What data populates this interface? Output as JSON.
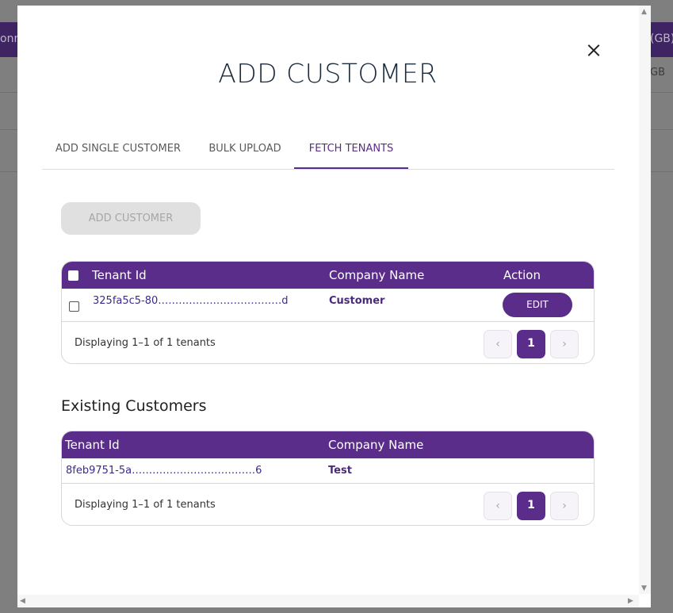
{
  "background": {
    "left_fragment": "onn",
    "right_fragment_top": "(GB)",
    "right_fragment_2": "GB"
  },
  "modal": {
    "title": "ADD CUSTOMER",
    "close_icon": "close-icon",
    "tabs": [
      {
        "label": "ADD SINGLE CUSTOMER",
        "active": false
      },
      {
        "label": "BULK UPLOAD",
        "active": false
      },
      {
        "label": "FETCH TENANTS",
        "active": true
      }
    ],
    "add_customer_button": "ADD CUSTOMER",
    "tenants_table": {
      "headers": {
        "tenant_id": "Tenant Id",
        "company_name": "Company Name",
        "action": "Action"
      },
      "rows": [
        {
          "tenant_id": "325fa5c5-80………………………………d",
          "company_name": "Customer",
          "action": "EDIT"
        }
      ],
      "footer": "Displaying 1–1 of 1 tenants",
      "pagination": {
        "prev": "‹",
        "current": "1",
        "next": "›"
      }
    },
    "existing_title": "Existing Customers",
    "existing_table": {
      "headers": {
        "tenant_id": "Tenant Id",
        "company_name": "Company Name"
      },
      "rows": [
        {
          "tenant_id": "8feb9751-5a………………………………6",
          "company_name": "Test"
        }
      ],
      "footer": "Displaying 1–1 of 1 tenants",
      "pagination": {
        "prev": "‹",
        "current": "1",
        "next": "›"
      }
    }
  },
  "colors": {
    "accent": "#5b2d8a",
    "overlay": "#7f7f7f"
  }
}
